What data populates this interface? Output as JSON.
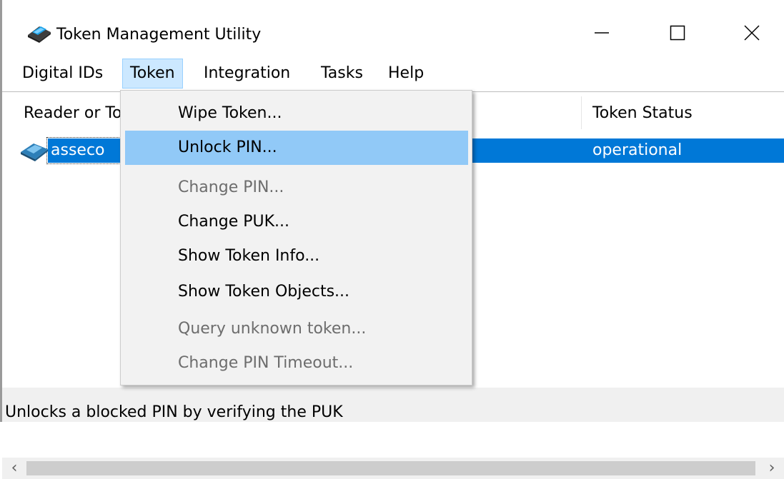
{
  "window": {
    "title": "Token Management Utility",
    "icons": {
      "app": "smart-card-reader-icon",
      "minimize": "minimize-icon",
      "maximize": "maximize-icon",
      "close": "close-icon"
    }
  },
  "menubar": {
    "items": [
      {
        "label": "Digital IDs"
      },
      {
        "label": "Token",
        "active": true
      },
      {
        "label": "Integration"
      },
      {
        "label": "Tasks"
      },
      {
        "label": "Help"
      }
    ]
  },
  "token_menu": {
    "items": [
      {
        "label": "Wipe Token...",
        "enabled": true
      },
      {
        "label": "Unlock PIN...",
        "enabled": true,
        "highlighted": true
      },
      {
        "label": "Change PIN...",
        "enabled": false
      },
      {
        "label": "Change PUK...",
        "enabled": true
      },
      {
        "label": "Show Token Info...",
        "enabled": true
      },
      {
        "label": "Show Token Objects...",
        "enabled": true
      },
      {
        "label": "Query unknown token...",
        "enabled": false
      },
      {
        "label": "Change PIN Timeout...",
        "enabled": false
      }
    ]
  },
  "list": {
    "columns": [
      "Reader or To",
      "Token Status"
    ],
    "rows": [
      {
        "name": "asseco",
        "status": "operational",
        "icon": "token-icon",
        "selected": true
      }
    ],
    "scroll": {
      "left": "‹",
      "right": "›"
    }
  },
  "status": {
    "text": "Unlocks a blocked PIN by verifying the PUK"
  },
  "colors": {
    "selection": "#0078d7",
    "menu_highlight": "#91c9f7",
    "menu_active": "#cce8ff"
  }
}
